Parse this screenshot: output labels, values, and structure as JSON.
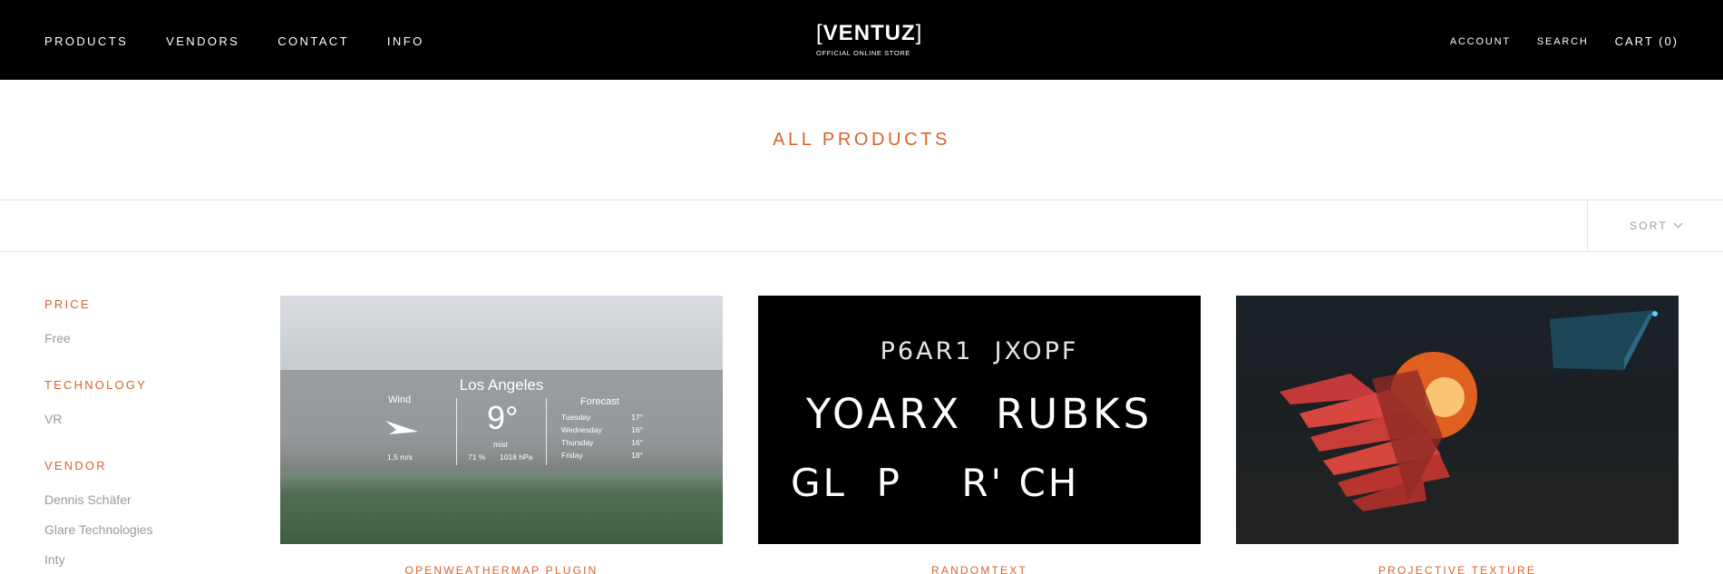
{
  "header": {
    "nav_left": [
      "PRODUCTS",
      "VENDORS",
      "CONTACT",
      "INFO"
    ],
    "logo": {
      "mark": "VENTUZ",
      "subtitle": "OFFICIAL ONLINE STORE"
    },
    "nav_right": {
      "account": "ACCOUNT",
      "search": "SEARCH",
      "cart": "CART (0)"
    }
  },
  "page_title": "ALL PRODUCTS",
  "toolbar": {
    "sort_label": "SORT"
  },
  "sidebar": {
    "filters": [
      {
        "title": "PRICE",
        "items": [
          "Free"
        ]
      },
      {
        "title": "TECHNOLOGY",
        "items": [
          "VR"
        ]
      },
      {
        "title": "VENDOR",
        "items": [
          "Dennis Schäfer",
          "Glare Technologies",
          "Inty"
        ]
      }
    ]
  },
  "products": [
    {
      "name": "OPENWEATHERMAP PLUGIN",
      "image": {
        "city": "Los Angeles",
        "wind_label": "Wind",
        "wind_speed": "1,5 m/s",
        "temperature": "9°",
        "condition": "mist",
        "humidity": "71 %",
        "pressure": "1018 hPa",
        "forecast_label": "Forecast",
        "forecast": [
          {
            "day": "Tuesday",
            "temp": "17°"
          },
          {
            "day": "Wednesday",
            "temp": "16°"
          },
          {
            "day": "Thursday",
            "temp": "16°"
          },
          {
            "day": "Friday",
            "temp": "18°"
          }
        ]
      }
    },
    {
      "name": "RANDOMTEXT",
      "image": {
        "lines": [
          "P6AR1  JXOPF",
          "YOARX  RUBKS",
          "GL  P    R' CH"
        ]
      }
    },
    {
      "name": "PROJECTIVE TEXTURE",
      "image": {}
    }
  ],
  "colors": {
    "accent": "#d9622b",
    "header_bg": "#000000",
    "muted_text": "#9a9a9a"
  }
}
